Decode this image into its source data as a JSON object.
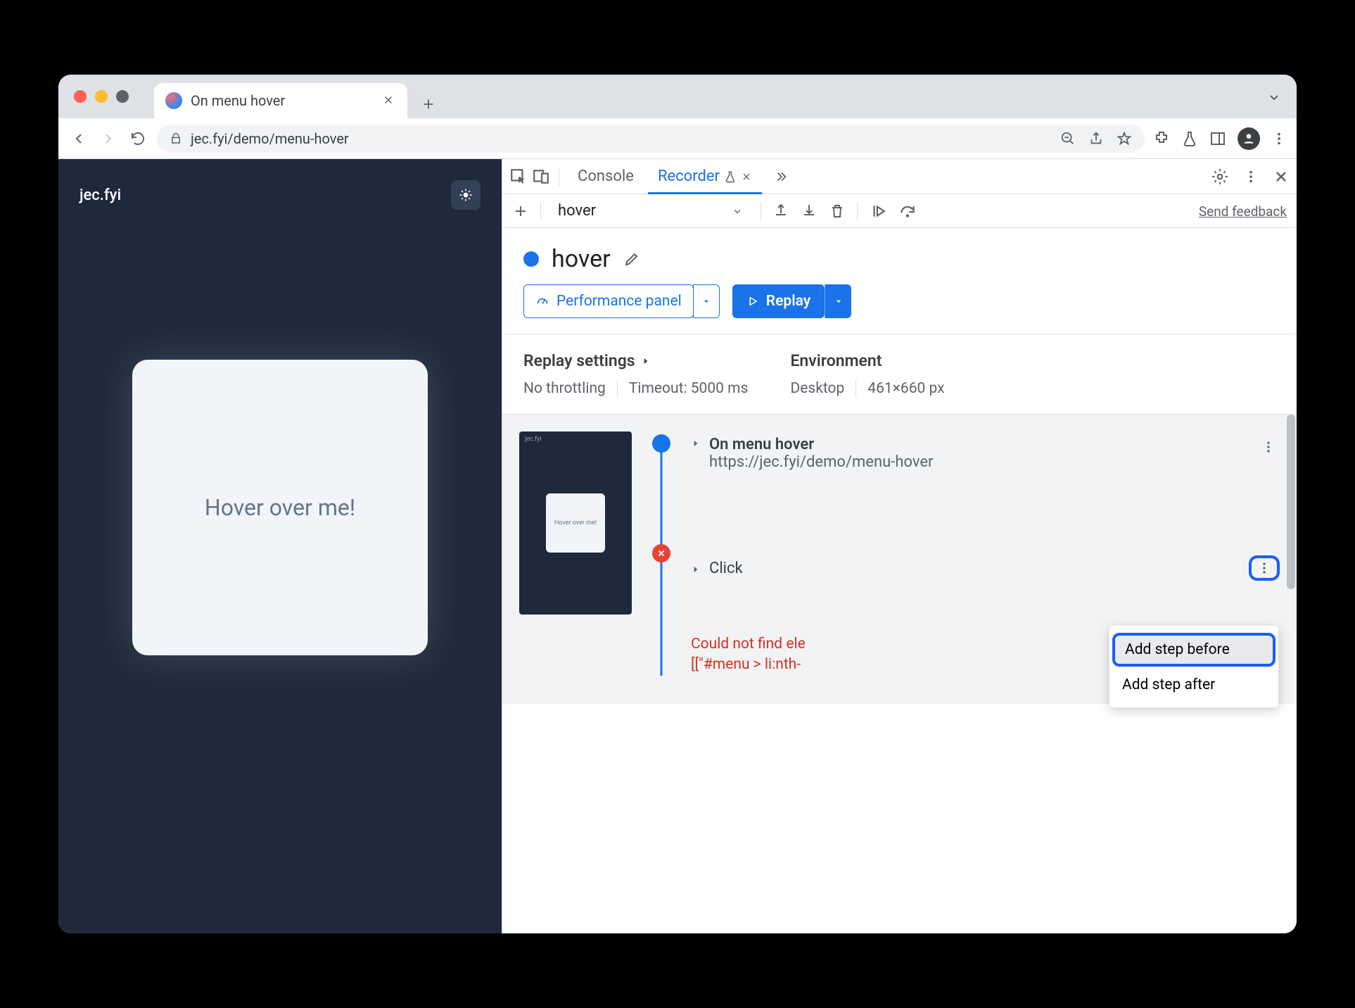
{
  "browser": {
    "tab_title": "On menu hover",
    "url_display": "jec.fyi/demo/menu-hover"
  },
  "page": {
    "brand": "jec.fyi",
    "card_text": "Hover over me!"
  },
  "devtools": {
    "tabs": {
      "console": "Console",
      "recorder": "Recorder"
    },
    "toolbar": {
      "recording_name": "hover",
      "feedback": "Send feedback"
    },
    "flow": {
      "title": "hover",
      "perf_button": "Performance panel",
      "replay_button": "Replay"
    },
    "settings": {
      "heading": "Replay settings",
      "throttling": "No throttling",
      "timeout": "Timeout: 5000 ms",
      "env_heading": "Environment",
      "env_device": "Desktop",
      "env_size": "461×660 px"
    },
    "steps": {
      "nav_title": "On menu hover",
      "nav_url": "https://jec.fyi/demo/menu-hover",
      "click_label": "Click",
      "thumb_text": "Hover over me!",
      "error_line1": "Could not find ele",
      "error_line2": "[[\"#menu > li:nth-"
    },
    "context_menu": {
      "before": "Add step before",
      "after": "Add step after"
    }
  }
}
